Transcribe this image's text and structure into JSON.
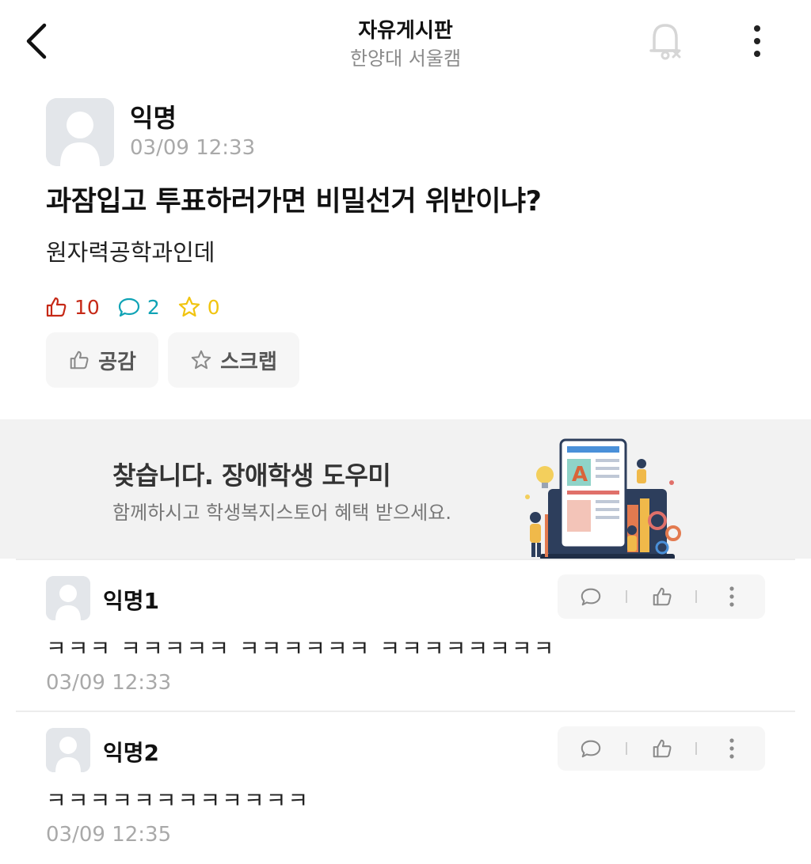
{
  "header": {
    "title": "자유게시판",
    "subtitle": "한양대 서울캠",
    "back_icon": "chevron-left-icon",
    "bell_icon": "bell-off-icon",
    "more_icon": "vertical-ellipsis-icon"
  },
  "post": {
    "author": "익명",
    "time": "03/09 12:33",
    "title": "과잠입고 투표하러가면 비밀선거 위반이냐?",
    "body": "원자력공학과인데",
    "likes": "10",
    "comments": "2",
    "scraps": "0",
    "like_button": "공감",
    "scrap_button": "스크랩"
  },
  "banner": {
    "title": "찾습니다. 장애학생 도우미",
    "subtitle": "함께하시고 학생복지스토어 혜택 받으세요."
  },
  "comments": [
    {
      "author": "익명1",
      "text": "ㅋㅋㅋ ㅋㅋㅋㅋㅋ ㅋㅋㅋㅋㅋㅋ ㅋㅋㅋㅋㅋㅋㅋㅋ",
      "time": "03/09 12:33"
    },
    {
      "author": "익명2",
      "text": "ㅋㅋㅋㅋㅋㅋㅋㅋㅋㅋㅋㅋ",
      "time": "03/09 12:35"
    }
  ],
  "colors": {
    "like": "#c62917",
    "comment": "#0fa3b5",
    "scrap": "#f1c40f",
    "muted": "#a9a9a9"
  }
}
